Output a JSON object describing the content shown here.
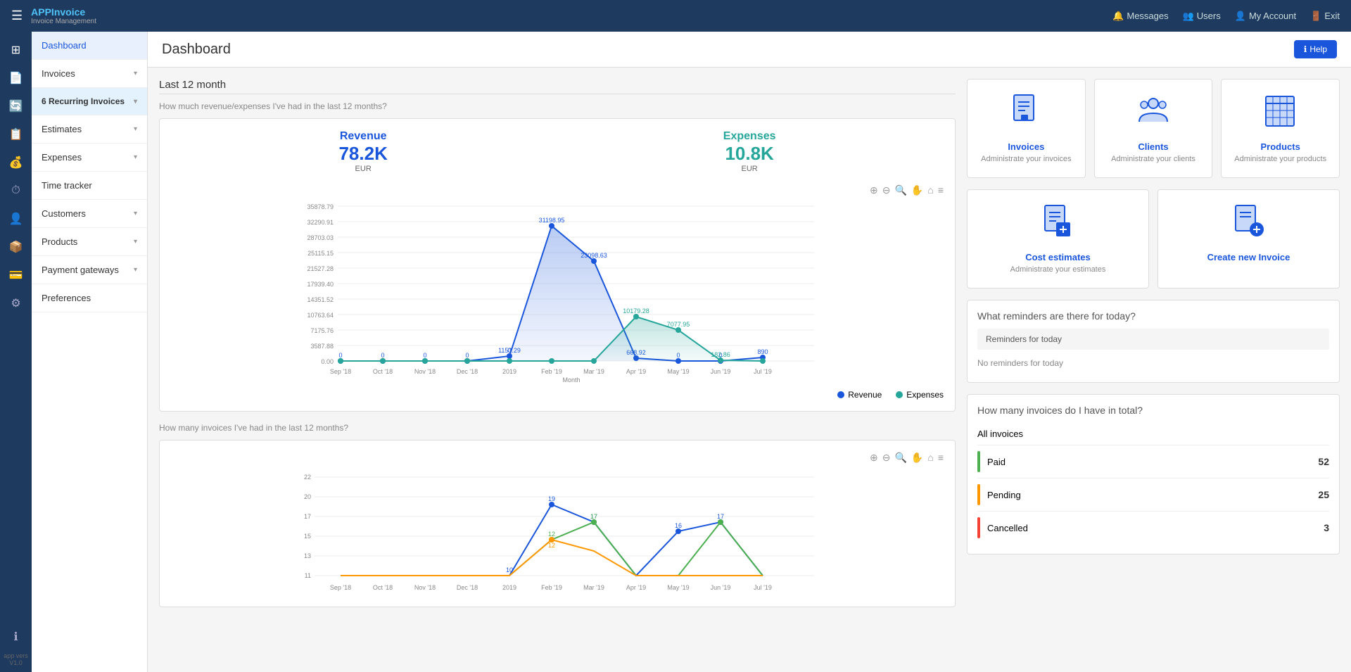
{
  "app": {
    "name": "APPInvoice",
    "subtitle": "Invoice Management",
    "version": "app vers V1.0"
  },
  "topnav": {
    "messages": "Messages",
    "users": "Users",
    "my_account": "My Account",
    "exit": "Exit"
  },
  "sidebar": {
    "items": [
      {
        "id": "dashboard",
        "label": "Dashboard",
        "hasChevron": false,
        "active": true
      },
      {
        "id": "invoices",
        "label": "Invoices",
        "hasChevron": true
      },
      {
        "id": "recurring",
        "label": "Recurring Invoices",
        "hasChevron": true,
        "badge": "6"
      },
      {
        "id": "estimates",
        "label": "Estimates",
        "hasChevron": true
      },
      {
        "id": "expenses",
        "label": "Expenses",
        "hasChevron": true
      },
      {
        "id": "timetracker",
        "label": "Time tracker",
        "hasChevron": false
      },
      {
        "id": "customers",
        "label": "Customers",
        "hasChevron": true
      },
      {
        "id": "products",
        "label": "Products",
        "hasChevron": true
      },
      {
        "id": "payment",
        "label": "Payment gateways",
        "hasChevron": true
      },
      {
        "id": "preferences",
        "label": "Preferences",
        "hasChevron": false
      }
    ]
  },
  "dashboard": {
    "title": "Dashboard",
    "help_label": "Help",
    "last12month": "Last 12 month",
    "revenue_question": "How much revenue/expenses I've had in the last 12 months?",
    "revenue_label": "Revenue",
    "revenue_value": "78.2K",
    "revenue_currency": "EUR",
    "expenses_label": "Expenses",
    "expenses_value": "10.8K",
    "expenses_currency": "EUR",
    "invoices_question": "How many invoices I've had in the last 12 months?"
  },
  "quicklinks": [
    {
      "id": "invoices",
      "title": "Invoices",
      "sub": "Administrate your invoices",
      "icon": "📄"
    },
    {
      "id": "clients",
      "title": "Clients",
      "sub": "Administrate your clients",
      "icon": "👥"
    },
    {
      "id": "products",
      "title": "Products",
      "sub": "Administrate your products",
      "icon": "📦"
    },
    {
      "id": "cost_estimates",
      "title": "Cost estimates",
      "sub": "Administrate your estimates",
      "icon": "📊"
    },
    {
      "id": "create_invoice",
      "title": "Create new Invoice",
      "sub": "",
      "icon": "📝"
    }
  ],
  "reminders": {
    "title": "What reminders are there for today?",
    "section_label": "Reminders for today",
    "no_reminder": "No reminders for today"
  },
  "invoicecount": {
    "title": "How many invoices do I have in total?",
    "all_label": "All invoices",
    "rows": [
      {
        "status": "Paid",
        "count": "52",
        "color": "green"
      },
      {
        "status": "Pending",
        "count": "25",
        "color": "orange"
      },
      {
        "status": "Cancelled",
        "count": "3",
        "color": "red"
      }
    ]
  },
  "chart": {
    "months": [
      "Sep '18",
      "Oct '18",
      "Nov '18",
      "Dec '18",
      "2019",
      "Feb '19",
      "Mar '19",
      "Apr '19",
      "May '19",
      "Jun '19",
      "Jul '19"
    ],
    "revenue_points": [
      0,
      0,
      0,
      0,
      1153.29,
      31198.95,
      23098.63,
      668.92,
      0,
      0,
      890
    ],
    "expenses_points": [
      0,
      0,
      0,
      0,
      0,
      0,
      0,
      10179.28,
      7077.95,
      182.86,
      0
    ],
    "y_labels": [
      "35878.79",
      "32290.91",
      "28703.03",
      "25115.15",
      "21527.28",
      "17939.40",
      "14351.52",
      "10763.64",
      "7175.76",
      "3587.88",
      "0.00"
    ],
    "legend_revenue": "Revenue",
    "legend_expenses": "Expenses",
    "x_label": "Month"
  },
  "chart2": {
    "y_labels": [
      22,
      20,
      17,
      15,
      13,
      11
    ],
    "months": [
      "Sep '18",
      "Oct '18",
      "Nov '18",
      "Dec '18",
      "2019",
      "Feb '19",
      "Mar '19",
      "Apr '19",
      "May '19",
      "Jun '19",
      "Jul '19"
    ]
  }
}
